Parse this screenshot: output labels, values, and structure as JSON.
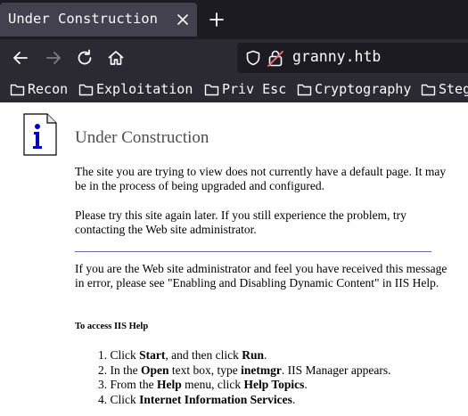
{
  "browser": {
    "tab_title": "Under Construction",
    "url": "granny.htb",
    "bookmarks": [
      "Recon",
      "Exploitation",
      "Priv Esc",
      "Cryptography",
      "Steg"
    ]
  },
  "page": {
    "title": "Under Construction",
    "para1": "The site you are trying to view does not currently have a default page. It may be in the process of being upgraded and configured.",
    "para2": "Please try this site again later. If you still experience the problem, try contacting the Web site administrator.",
    "para3": "If you are the Web site administrator and feel you have received this message in error, please see \"Enabling and Disabling Dynamic Content\" in IIS Help.",
    "subheading": "To access IIS Help",
    "steps": [
      {
        "n": "1.",
        "a": "Click ",
        "b1": "Start",
        "c": ", and then click ",
        "b2": "Run",
        "d": "."
      },
      {
        "n": "2.",
        "a": "In the ",
        "b1": "Open",
        "c": " text box, type ",
        "b2": "inetmgr",
        "d": ". IIS Manager appears."
      },
      {
        "n": "3.",
        "a": "From the ",
        "b1": "Help",
        "c": " menu, click ",
        "b2": "Help Topics",
        "d": "."
      },
      {
        "n": "4.",
        "a": "Click ",
        "b1": "Internet Information Services",
        "c": "",
        "b2": "",
        "d": "."
      }
    ]
  }
}
